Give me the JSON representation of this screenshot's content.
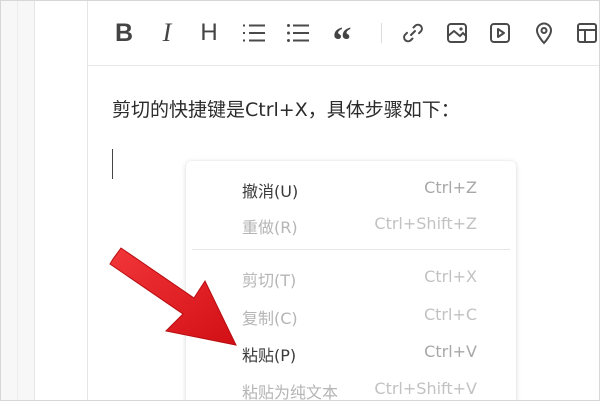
{
  "editor": {
    "content_text": "剪切的快捷键是Ctrl+X，具体步骤如下："
  },
  "toolbar": {
    "bold_glyph": "B",
    "italic_glyph": "I",
    "heading_glyph": "H",
    "quote_glyph": "“",
    "items": [
      "bold",
      "italic",
      "heading",
      "ordered-list",
      "unordered-list",
      "quote",
      "link",
      "image",
      "video",
      "location",
      "table"
    ]
  },
  "context_menu": {
    "undo": {
      "label": "撤消(U)",
      "shortcut": "Ctrl+Z"
    },
    "redo": {
      "label": "重做(R)",
      "shortcut": "Ctrl+Shift+Z"
    },
    "cut": {
      "label": "剪切(T)",
      "shortcut": "Ctrl+X"
    },
    "copy": {
      "label": "复制(C)",
      "shortcut": "Ctrl+C"
    },
    "paste": {
      "label": "粘贴(P)",
      "shortcut": "Ctrl+V"
    },
    "paste_plain": {
      "label": "粘贴为纯文本",
      "shortcut": "Ctrl+Shift+V"
    }
  },
  "colors": {
    "annotation_arrow": "#e8171c",
    "icon": "#4a4a4a",
    "disabled_text": "#b5b5b5"
  }
}
